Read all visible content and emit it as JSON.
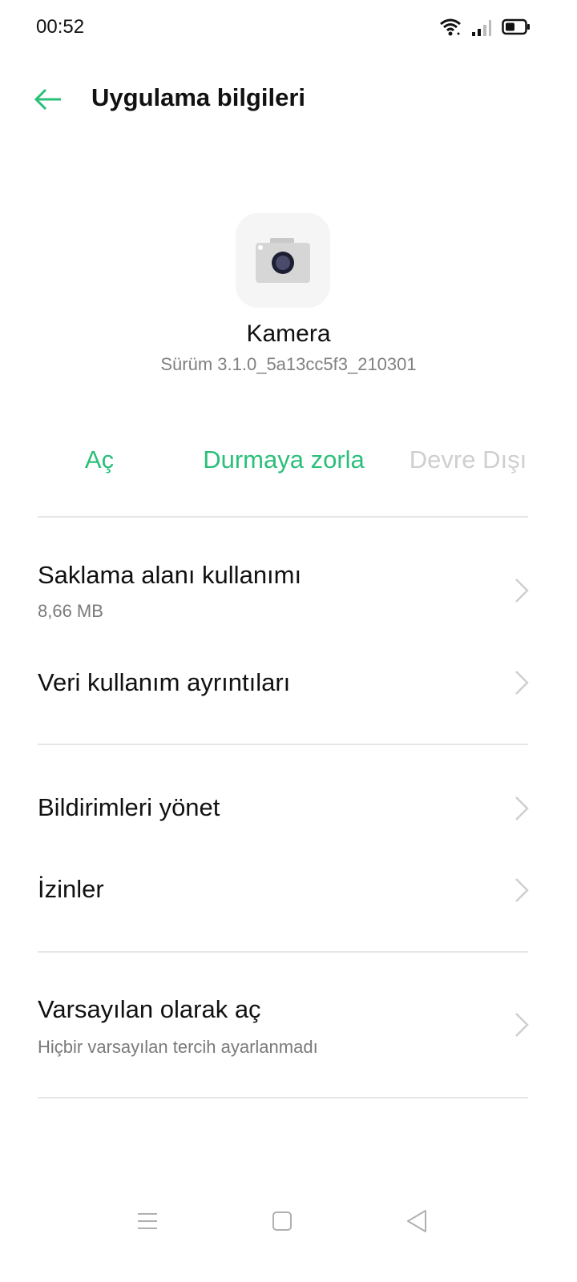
{
  "status_bar": {
    "time": "00:52"
  },
  "header": {
    "title": "Uygulama bilgileri"
  },
  "app": {
    "name": "Kamera",
    "version": "Sürüm 3.1.0_5a13cc5f3_210301"
  },
  "actions": {
    "open": "Aç",
    "force_stop": "Durmaya zorla",
    "disable": "Devre Dışı"
  },
  "items": [
    {
      "title": "Saklama alanı kullanımı",
      "subtitle": "8,66 MB"
    },
    {
      "title": "Veri kullanım ayrıntıları"
    },
    {
      "title": "Bildirimleri yönet"
    },
    {
      "title": "İzinler"
    },
    {
      "title": "Varsayılan olarak aç",
      "subtitle": "Hiçbir varsayılan tercih ayarlanmadı"
    }
  ],
  "colors": {
    "accent": "#2bbf7a",
    "disabled": "#cfcfcf",
    "divider": "#e6e6e6"
  },
  "icons": [
    "wifi-icon",
    "signal-icon",
    "battery-icon",
    "back-arrow-icon",
    "camera-icon",
    "chevron-right-icon",
    "menu-icon",
    "home-icon",
    "back-icon"
  ]
}
